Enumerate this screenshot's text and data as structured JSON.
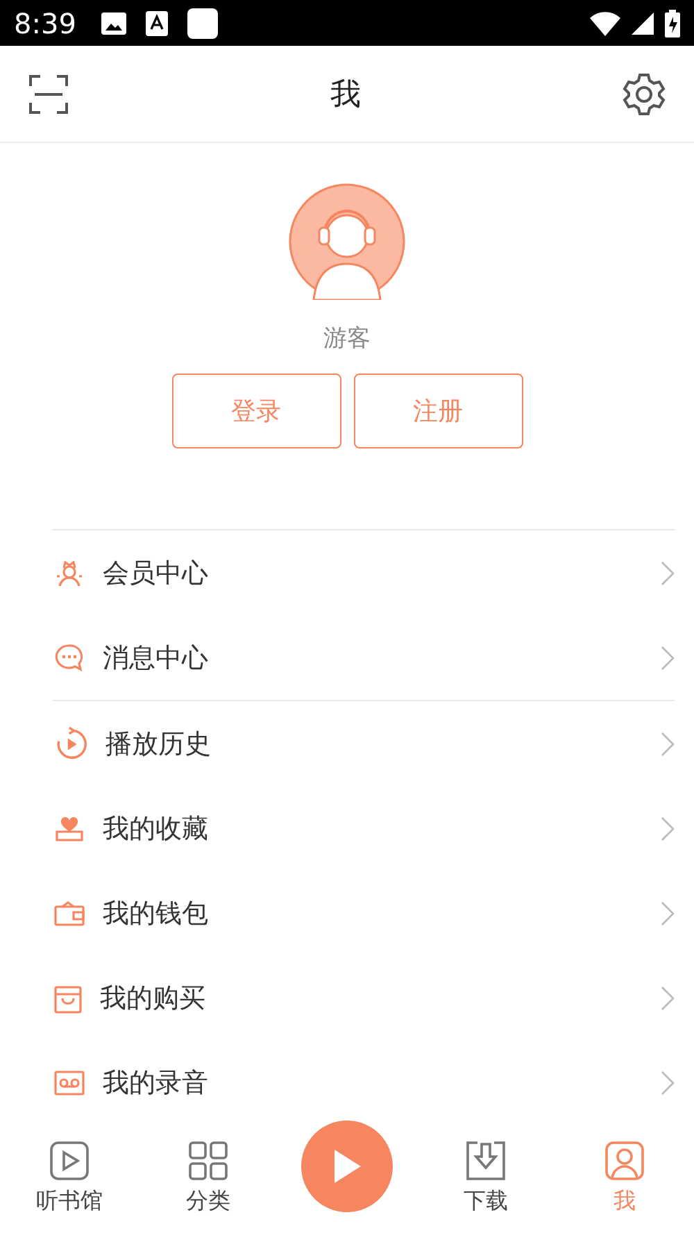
{
  "status_bar": {
    "time": "8:39"
  },
  "header": {
    "title": "我"
  },
  "profile": {
    "name": "游客",
    "buttons": [
      "登录",
      "注册"
    ]
  },
  "menu_groups": [
    [
      {
        "label": "会员中心"
      },
      {
        "label": "消息中心"
      }
    ],
    [
      {
        "label": "播放历史"
      },
      {
        "label": "我的收藏"
      },
      {
        "label": "我的钱包"
      },
      {
        "label": "我的购买"
      },
      {
        "label": "我的录音"
      }
    ]
  ],
  "tabs": [
    {
      "label": "听书馆",
      "selected": false
    },
    {
      "label": "分类",
      "selected": false
    },
    {
      "kind": "play"
    },
    {
      "label": "下载",
      "selected": false
    },
    {
      "label": "我",
      "selected": true
    }
  ]
}
